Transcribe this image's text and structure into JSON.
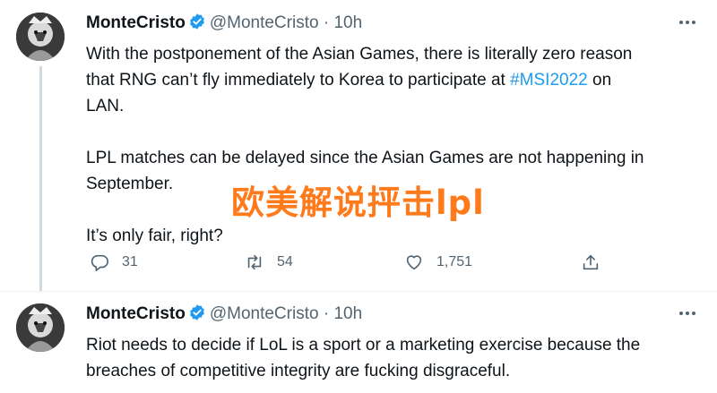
{
  "tweets": [
    {
      "author_name": "MonteCristo",
      "handle": "@MonteCristo",
      "separator": "·",
      "time": "10h",
      "text_lines": [
        [
          "With the postponement of the Asian Games, there is literally zero reason"
        ],
        [
          "that RNG can’t fly immediately to Korea to participate at ",
          "#MSI2022",
          " on"
        ],
        [
          "LAN."
        ]
      ],
      "paragraph2": "LPL matches can be delayed since the Asian Games are not happening in September.",
      "paragraph2_lines": [
        "LPL matches can be delayed since the Asian Games are not happening in",
        "September."
      ],
      "paragraph3": "It’s only fair, right?",
      "replies": "31",
      "retweets": "54",
      "likes": "1,751"
    },
    {
      "author_name": "MonteCristo",
      "handle": "@MonteCristo",
      "separator": "·",
      "time": "10h",
      "text_lines": [
        "Riot needs to decide if LoL is a sport or a marketing exercise because the",
        "breaches of competitive integrity are fucking disgraceful."
      ]
    }
  ],
  "watermark": "欧美解说抨击lpl",
  "icons": {
    "verified": "verified-badge-icon",
    "more": "more-options-icon",
    "reply": "reply-icon",
    "retweet": "retweet-icon",
    "like": "heart-icon",
    "share": "share-icon"
  },
  "colors": {
    "accent": "#1d9bf0",
    "muted": "#536471",
    "watermark": "#ff7a1a"
  }
}
